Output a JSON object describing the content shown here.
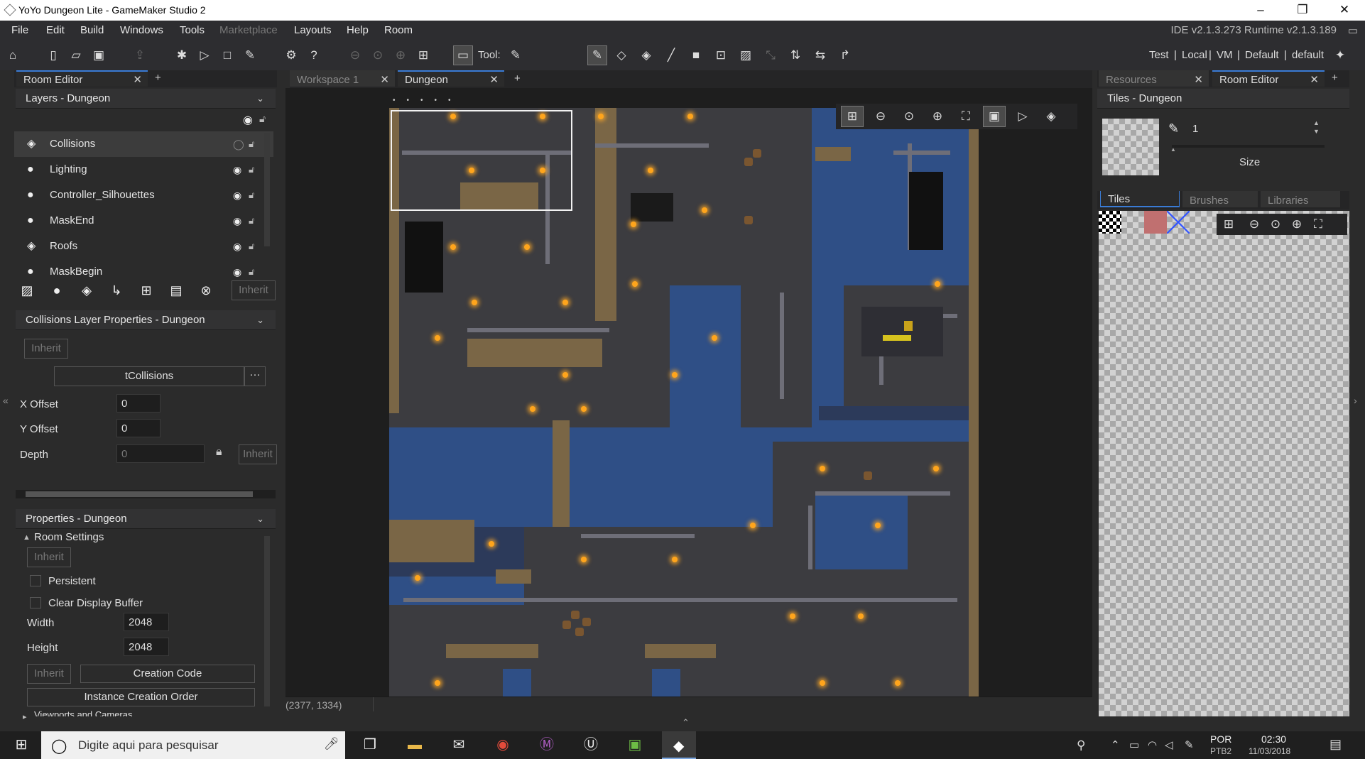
{
  "window": {
    "title": "YoYo Dungeon Lite - GameMaker Studio 2",
    "min": "–",
    "max": "❐",
    "close": "✕"
  },
  "menu": {
    "items": [
      "File",
      "Edit",
      "Build",
      "Windows",
      "Tools",
      "Marketplace",
      "Layouts",
      "Help",
      "Room"
    ],
    "ide_version": "IDE v2.1.3.273 Runtime v2.1.3.189"
  },
  "toolbar": {
    "tool_label": "Tool:",
    "targets": [
      "Test",
      "Local",
      "VM",
      "Default",
      "default"
    ],
    "separator": "|"
  },
  "left": {
    "tab": "Room Editor",
    "layers_header": "Layers - Dungeon",
    "layers": [
      {
        "name": "Collisions",
        "icon": "tile-layer-icon",
        "selected": true
      },
      {
        "name": "Lighting",
        "icon": "instance-layer-icon"
      },
      {
        "name": "Controller_Silhouettes",
        "icon": "instance-layer-icon"
      },
      {
        "name": "MaskEnd",
        "icon": "instance-layer-icon"
      },
      {
        "name": "Roofs",
        "icon": "tile-layer-icon"
      },
      {
        "name": "MaskBegin",
        "icon": "instance-layer-icon"
      }
    ],
    "inherit": "Inherit",
    "collisions_header": "Collisions Layer Properties - Dungeon",
    "tileset": "tCollisions",
    "ellipsis": "···",
    "x_offset_label": "X Offset",
    "x_offset": "0",
    "y_offset_label": "Y Offset",
    "y_offset": "0",
    "depth_label": "Depth",
    "depth": "0",
    "properties_header": "Properties - Dungeon",
    "room_settings": "Room Settings",
    "persistent": "Persistent",
    "clear_display_buffer": "Clear Display Buffer",
    "width_label": "Width",
    "width": "2048",
    "height_label": "Height",
    "height": "2048",
    "creation_code": "Creation Code",
    "instance_creation_order": "Instance Creation Order",
    "viewports": "Viewports and Cameras"
  },
  "center": {
    "tabs": [
      {
        "label": "Workspace 1",
        "active": false
      },
      {
        "label": "Dungeon",
        "active": true
      }
    ],
    "add": "+",
    "cursor_coords": "(2377, 1334)"
  },
  "right": {
    "tabs": [
      {
        "label": "Resources",
        "active": false
      },
      {
        "label": "Room Editor",
        "active": true
      }
    ],
    "tiles_header": "Tiles - Dungeon",
    "brush_value": "1",
    "size_label": "Size",
    "subtabs": [
      {
        "label": "Tiles",
        "active": true
      },
      {
        "label": "Brushes",
        "active": false
      },
      {
        "label": "Libraries",
        "active": false
      }
    ]
  },
  "taskbar": {
    "search_placeholder": "Digite aqui para pesquisar",
    "lang": "POR",
    "lang2": "PTB2",
    "time": "02:30",
    "date": "11/03/2018"
  },
  "colors": {
    "accent": "#3a7bd5",
    "torch": "#ffa51c",
    "water": "#2f4f86"
  }
}
